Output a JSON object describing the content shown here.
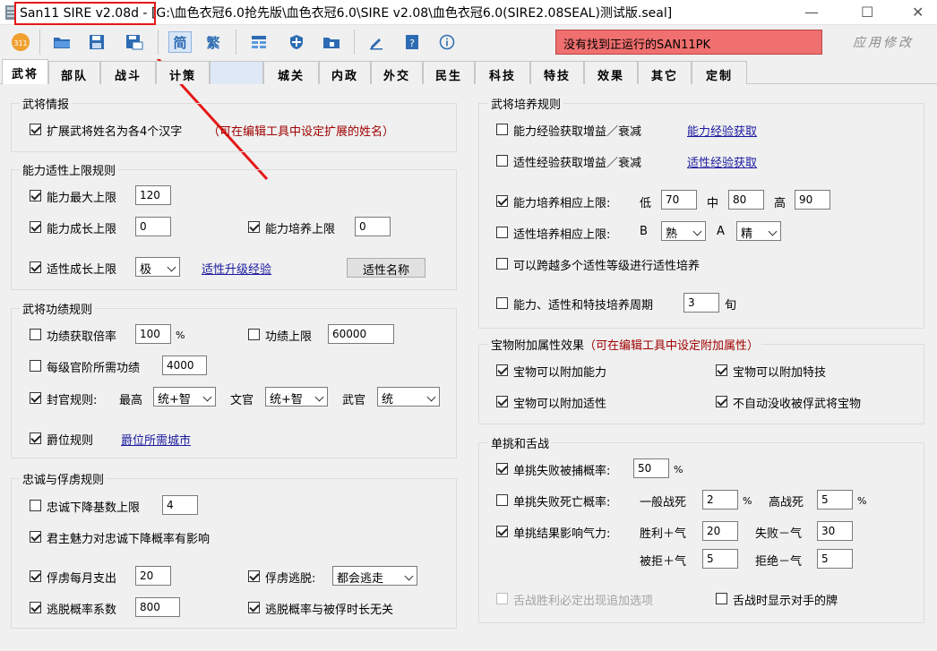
{
  "window": {
    "title": "San11 SIRE v2.08d - [G:\\血色衣冠6.0抢先版\\血色衣冠6.0\\SIRE v2.08\\血色衣冠6.0(SIRE2.08SEAL)测试版.seal]"
  },
  "toolbar": {
    "status": "没有找到正运行的SAN11PK",
    "apply_label": "应用修改",
    "simplified_label": "简",
    "traditional_label": "繁",
    "icons": [
      "san11-icon",
      "folder-open-icon",
      "save-icon",
      "save-as-icon",
      "simplified-chinese",
      "traditional-chinese",
      "grid-icon",
      "shield-icon",
      "lock-folder-icon",
      "edit-icon",
      "help-icon",
      "info-icon"
    ]
  },
  "tabs": [
    "武将",
    "部队",
    "战斗",
    "计策",
    "",
    "城关",
    "内政",
    "外交",
    "民生",
    "科技",
    "特技",
    "效果",
    "其它",
    "定制"
  ],
  "colors": {
    "status_bg": "#f06f6f",
    "highlight": "#e51919",
    "link": "#1a1aa0",
    "note": "#a00000"
  },
  "wujiang_info": {
    "title": "武将情报",
    "extend_name": {
      "label": "扩展武将姓名为各4个汉字",
      "checked": true
    },
    "note": "（可在编辑工具中设定扩展的姓名）"
  },
  "ability_limit": {
    "title": "能力适性上限规则",
    "max": {
      "label": "能力最大上限",
      "checked": true,
      "value": "120"
    },
    "growth": {
      "label": "能力成长上限",
      "checked": true,
      "value": "0"
    },
    "train": {
      "label": "能力培养上限",
      "checked": true,
      "value": "0"
    },
    "aptitude_growth": {
      "label": "适性成长上限",
      "checked": true,
      "value": "极"
    },
    "upgrade_link": "适性升级经验",
    "names_button": "适性名称"
  },
  "merit": {
    "title": "武将功绩规则",
    "gain_rate": {
      "label": "功绩获取倍率",
      "checked": false,
      "value": "100",
      "unit": "%"
    },
    "merit_limit": {
      "label": "功绩上限",
      "checked": false,
      "value": "60000"
    },
    "per_rank": {
      "label": "每级官阶所需功绩",
      "checked": false,
      "value": "4000"
    },
    "rank_rule": {
      "label": "封官规则:",
      "checked": true,
      "max_label": "最高",
      "max_value": "统+智",
      "civil_label": "文官",
      "civil_value": "统+智",
      "military_label": "武官",
      "military_value": "统"
    },
    "peerage": {
      "label": "爵位规则",
      "checked": true,
      "link": "爵位所需城市"
    }
  },
  "loyalty": {
    "title": "忠诚与俘虏规则",
    "loyalty_drop": {
      "label": "忠诚下降基数上限",
      "checked": false,
      "value": "4"
    },
    "charisma": {
      "label": "君主魅力对忠诚下降概率有影响",
      "checked": true
    },
    "monthly_cost": {
      "label": "俘虏每月支出",
      "checked": true,
      "value": "20"
    },
    "escape": {
      "label": "俘虏逃脱:",
      "checked": true,
      "value": "都会逃走"
    },
    "escape_factor": {
      "label": "逃脱概率系数",
      "checked": true,
      "value": "800"
    },
    "escape_time": {
      "label": "逃脱概率与被俘时长无关",
      "checked": true
    }
  },
  "training": {
    "title": "武将培养规则",
    "ability_exp": {
      "label": "能力经验获取增益／衰减",
      "checked": false,
      "link": "能力经验获取"
    },
    "aptitude_exp": {
      "label": "适性经验获取增益／衰减",
      "checked": false,
      "link": "适性经验获取"
    },
    "ability_limit": {
      "label": "能力培养相应上限:",
      "checked": true,
      "low_label": "低",
      "low": "70",
      "mid_label": "中",
      "mid": "80",
      "high_label": "高",
      "high": "90"
    },
    "aptitude_limit": {
      "label": "适性培养相应上限:",
      "checked": false,
      "b_label": "B",
      "b_value": "熟",
      "a_label": "A",
      "a_value": "精"
    },
    "skip_level": {
      "label": "可以跨越多个适性等级进行适性培养",
      "checked": false
    },
    "period": {
      "label": "能力、适性和特技培养周期",
      "checked": false,
      "value": "3",
      "unit": "旬"
    }
  },
  "treasure": {
    "title": "宝物附加属性效果",
    "note": "（可在编辑工具中设定附加属性）",
    "ability": {
      "label": "宝物可以附加能力",
      "checked": true
    },
    "skill": {
      "label": "宝物可以附加特技",
      "checked": true
    },
    "aptitude": {
      "label": "宝物可以附加适性",
      "checked": true
    },
    "no_confiscate": {
      "label": "不自动没收被俘武将宝物",
      "checked": true
    }
  },
  "duel": {
    "title": "单挑和舌战",
    "capture": {
      "label": "单挑失败被捕概率:",
      "checked": true,
      "value": "50",
      "unit": "%"
    },
    "death": {
      "label": "单挑失败死亡概率:",
      "checked": false,
      "normal_label": "一般战死",
      "normal": "2",
      "high_label": "高战死",
      "high": "5",
      "unit": "%"
    },
    "morale": {
      "label": "单挑结果影响气力:",
      "checked": true,
      "win_label": "胜利＋气",
      "win": "20",
      "lose_label": "失败－气",
      "lose": "30",
      "reject_label": "被拒＋气",
      "reject": "5",
      "refuse_label": "拒绝－气",
      "refuse": "5"
    },
    "debate_extra": {
      "label": "舌战胜利必定出现追加选项",
      "checked": false,
      "disabled": true
    },
    "debate_show": {
      "label": "舌战时显示对手的牌",
      "checked": false
    }
  }
}
